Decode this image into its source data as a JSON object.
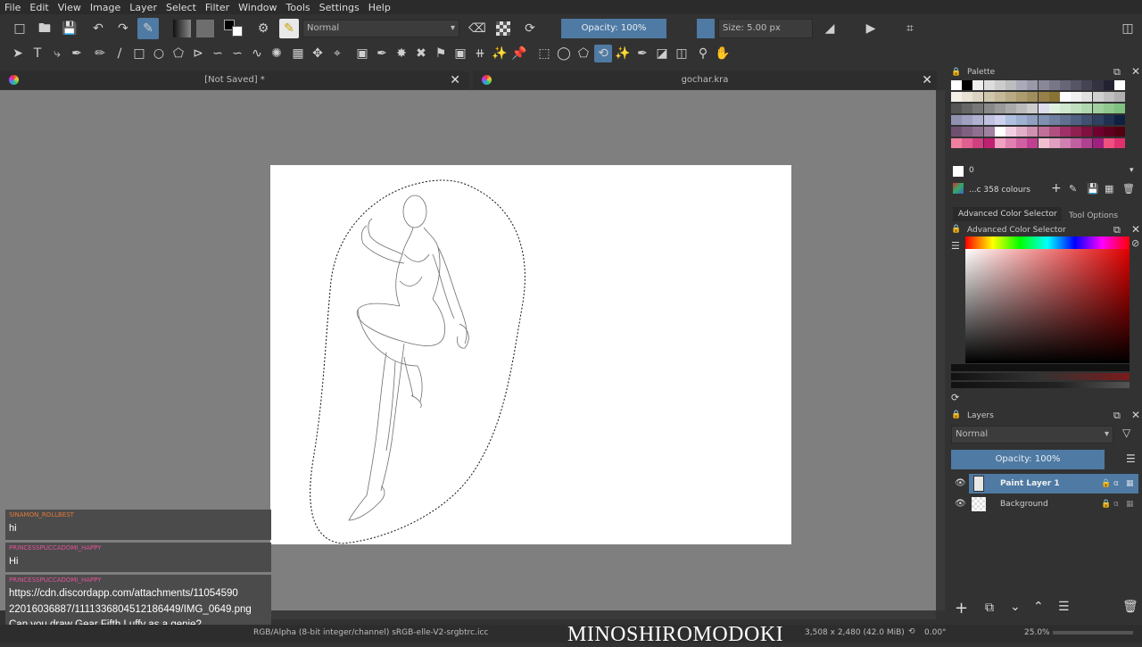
{
  "menu": [
    "File",
    "Edit",
    "View",
    "Image",
    "Layer",
    "Select",
    "Filter",
    "Window",
    "Tools",
    "Settings",
    "Help"
  ],
  "toolbar": {
    "blend_mode": "Normal",
    "opacity_label": "Opacity: 100%",
    "size_label": "Size: 5.00 px"
  },
  "tabs": [
    {
      "title": "[Not Saved]  *"
    },
    {
      "title": "gochar.kra"
    }
  ],
  "palette": {
    "title": "Palette",
    "index_value": "0",
    "colours_label": "...c 358 colours"
  },
  "dock_tabs": {
    "color_selector_tab": "Advanced Color Selector",
    "tool_options_tab": "Tool Options"
  },
  "color_selector": {
    "title": "Advanced Color Selector"
  },
  "layers": {
    "title": "Layers",
    "blend_mode": "Normal",
    "opacity_label": "Opacity:  100%",
    "items": [
      {
        "name": "Paint Layer 1",
        "selected": true
      },
      {
        "name": "Background",
        "selected": false
      }
    ]
  },
  "status": {
    "color_model": "RGB/Alpha (8-bit integer/channel)  sRGB-elle-V2-srgbtrc.icc",
    "dimensions": "3,508 x 2,480 (42.0 MiB)",
    "rotation": "0.00°",
    "zoom": "25.0%",
    "watermark": "MINOSHIROMODOKI"
  },
  "chat": [
    {
      "user": "SINAMON_ROLLBEST",
      "text": "hi"
    },
    {
      "user": "PRINCESSPUCCADOMI_HAPPY",
      "text": "Hi"
    },
    {
      "user": "PRINCESSPUCCADOMI_HAPPY",
      "text_lines": [
        "https://cdn.discordapp.com/attachments/11054590",
        "22016036887/1111336804512186449/IMG_0649.png",
        "Can you draw Gear Fifth Luffy as a genie?"
      ]
    }
  ],
  "colors": {
    "accent": "#4e7aa3",
    "canvas_bg": "#7f7f7f",
    "panel_bg": "#323232",
    "chat_user": "#e0549a"
  }
}
